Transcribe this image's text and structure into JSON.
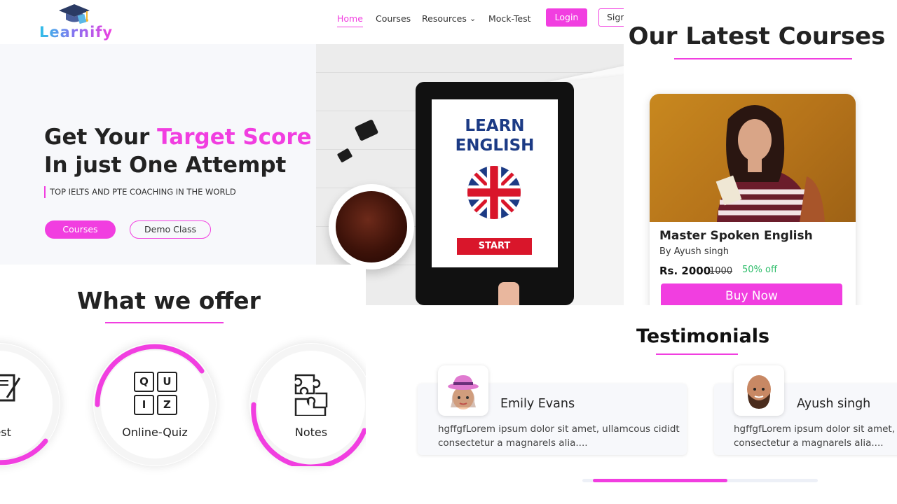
{
  "brand": {
    "name": "Learnify"
  },
  "nav": {
    "items": [
      "Home",
      "Courses",
      "Resources",
      "Mock-Test"
    ],
    "active": "Home",
    "login_label": "Login",
    "signup_label": "Sign"
  },
  "hero": {
    "title_part1": "Get Your ",
    "title_highlight": "Target Score",
    "title_part2": " In just  One Attempt",
    "subtitle": "TOP IELTS AND PTE COACHING IN THE WORLD",
    "primary_button": "Courses",
    "secondary_button": "Demo Class",
    "tablet_heading_1": "LEARN",
    "tablet_heading_2": "ENGLISH",
    "tablet_button": "START"
  },
  "latest_courses": {
    "title": "Our Latest Courses",
    "card": {
      "name": "Master Spoken English",
      "author": "By Ayush singh",
      "price": "Rs. 2000",
      "old_price": "1000",
      "discount": "50% off",
      "buy_label": "Buy Now"
    }
  },
  "offer": {
    "title": "What we offer",
    "items": [
      {
        "label": "-Test",
        "icon": "mock-test-icon"
      },
      {
        "label": "Online-Quiz",
        "icon": "quiz-icon",
        "letters": [
          "Q",
          "U",
          "I",
          "Z"
        ]
      },
      {
        "label": "Notes",
        "icon": "puzzle-icon"
      }
    ]
  },
  "testimonials": {
    "title": "Testimonials",
    "items": [
      {
        "name": "Emily Evans",
        "text_line1": "hgffgfLorem ipsum dolor sit amet, ullamcous cididt",
        "text_line2": "consectetur a magnarels alia....",
        "avatar": "woman-avatar-icon"
      },
      {
        "name": "Ayush singh",
        "text_line1": "hgffgfLorem ipsum dolor sit amet, ull",
        "text_line2": "consectetur a magnarels alia....",
        "avatar": "man-avatar-icon"
      }
    ]
  },
  "colors": {
    "accent": "#f13ee0",
    "discount": "#2ebd6a",
    "text": "#222222"
  }
}
